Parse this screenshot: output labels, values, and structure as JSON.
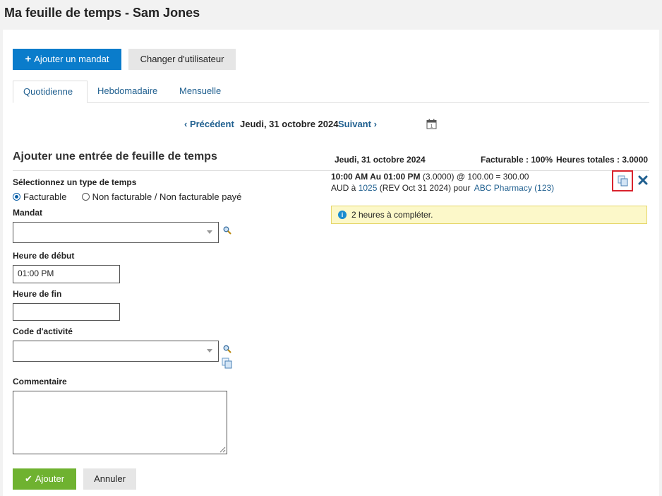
{
  "page": {
    "title": "Ma feuille de temps - Sam Jones"
  },
  "toolbar": {
    "add_matter_label": "Ajouter un mandat",
    "change_user_label": "Changer d'utilisateur"
  },
  "tabs": [
    {
      "label": "Quotidienne",
      "active": true
    },
    {
      "label": "Hebdomadaire",
      "active": false
    },
    {
      "label": "Mensuelle",
      "active": false
    }
  ],
  "datenav": {
    "prev_label": "‹ Précédent",
    "current_date": "Jeudi, 31 octobre 2024",
    "next_label": "Suivant ›",
    "calendar_icon": "calendar-icon"
  },
  "form": {
    "title": "Ajouter une entrée de feuille de temps",
    "time_type_label": "Sélectionnez un type de temps",
    "time_type_options": [
      "Facturable",
      "Non facturable / Non facturable payé"
    ],
    "time_type_selected": "Facturable",
    "matter_label": "Mandat",
    "matter_value": "",
    "start_label": "Heure de début",
    "start_value": "01:00 PM",
    "end_label": "Heure de fin",
    "end_value": "",
    "activity_label": "Code d'activité",
    "activity_value": "",
    "comment_label": "Commentaire",
    "comment_value": "",
    "submit_label": "Ajouter",
    "cancel_label": "Annuler"
  },
  "summary": {
    "date": "Jeudi, 31 octobre 2024",
    "billable": "Facturable : 100%",
    "total_hours": "Heures totales : 3.0000"
  },
  "entry": {
    "time_range": "10:00 AM Au 01:00 PM",
    "calc": " (3.0000) @ 100.00 = 300.00",
    "line2_prefix": "AUD à ",
    "code": "1025",
    "rev": " (REV Oct 31 2024) pour ",
    "client": "ABC Pharmacy (123)"
  },
  "notice": {
    "text": "2 heures à compléter."
  },
  "colors": {
    "primary": "#0a7ccb",
    "success": "#6fb230",
    "link": "#1f5f8f",
    "highlight_border": "#d9232d",
    "notice_bg": "#fcf8c9"
  }
}
